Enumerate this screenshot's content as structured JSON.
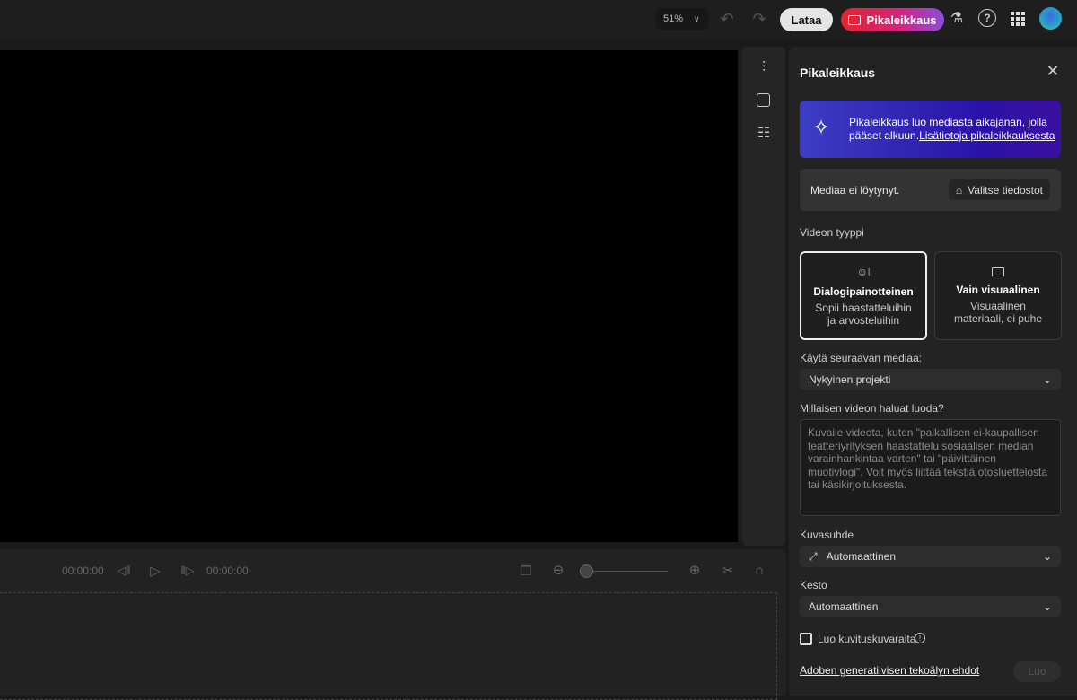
{
  "topbar": {
    "zoom": "51%",
    "download_label": "Lataa",
    "quickcut_label": "Pikaleikkaus"
  },
  "timeline": {
    "current_time": "00:00:00",
    "end_time": "00:00:00",
    "zoom_level": 0
  },
  "panel": {
    "title": "Pikaleikkaus",
    "banner_text": "Pikaleikkaus luo mediasta aikajanan, jolla pääset alkuun.",
    "banner_link": "Lisätietoja pikaleikkauksesta",
    "no_media": "Mediaa ei löytynyt.",
    "select_files": "Valitse tiedostot",
    "video_type_label": "Videon tyyppi",
    "video_types": [
      {
        "title": "Dialogipainotteinen",
        "desc": "Sopii haastatteluihin ja arvosteluihin",
        "selected": true
      },
      {
        "title": "Vain visuaalinen",
        "desc": "Visuaalinen materiaali, ei puhe",
        "selected": false
      }
    ],
    "media_source_label": "Käytä seuraavan mediaa:",
    "media_source_value": "Nykyinen projekti",
    "prompt_label": "Millaisen videon haluat luoda?",
    "prompt_placeholder": "Kuvaile videota, kuten \"paikallisen ei-kaupallisen teatteriyrityksen haastattelu sosiaalisen median varainhankintaa varten\" tai \"päivittäinen muotivlogi\". Voit myös liittää tekstiä otosluettelosta tai käsikirjoituksesta.",
    "prompt_value": "",
    "aspect_label": "Kuvasuhde",
    "aspect_value": "Automaattinen",
    "duration_label": "Kesto",
    "duration_value": "Automaattinen",
    "broll_label": "Luo kuvituskuvaraita",
    "broll_checked": false,
    "terms_link": "Adoben generatiivisen tekoälyn ehdot",
    "create_label": "Luo"
  }
}
